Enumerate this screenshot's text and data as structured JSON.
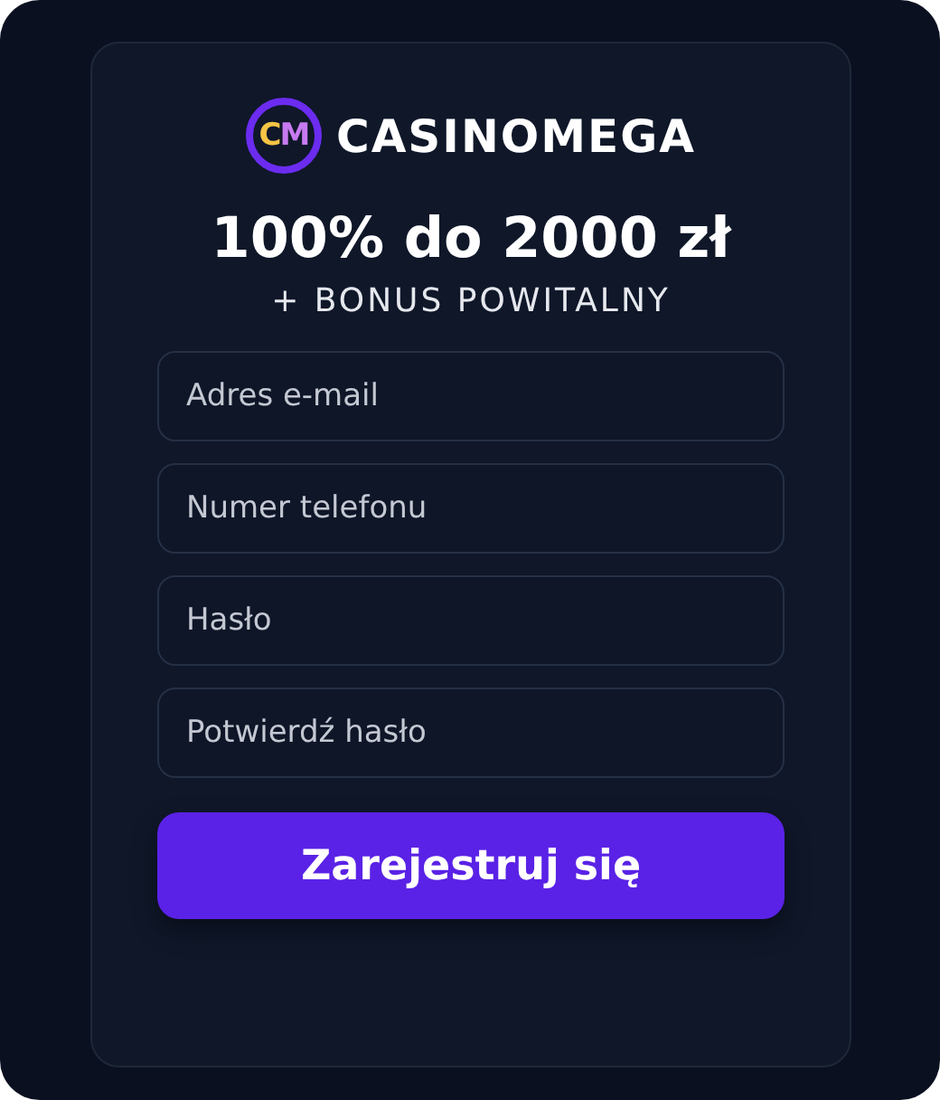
{
  "logo": {
    "mark": [
      "C",
      "M"
    ],
    "name": "CASINOMEGA"
  },
  "headline": "100% do 2000 zł",
  "subheadline": "+ BONUS POWITALNY",
  "fields": [
    {
      "placeholder": "Adres e-mail"
    },
    {
      "placeholder": "Numer telefonu"
    },
    {
      "placeholder": "Hasło"
    },
    {
      "placeholder": "Potwierdź hasło"
    }
  ],
  "submit": "Zarejestruj się"
}
